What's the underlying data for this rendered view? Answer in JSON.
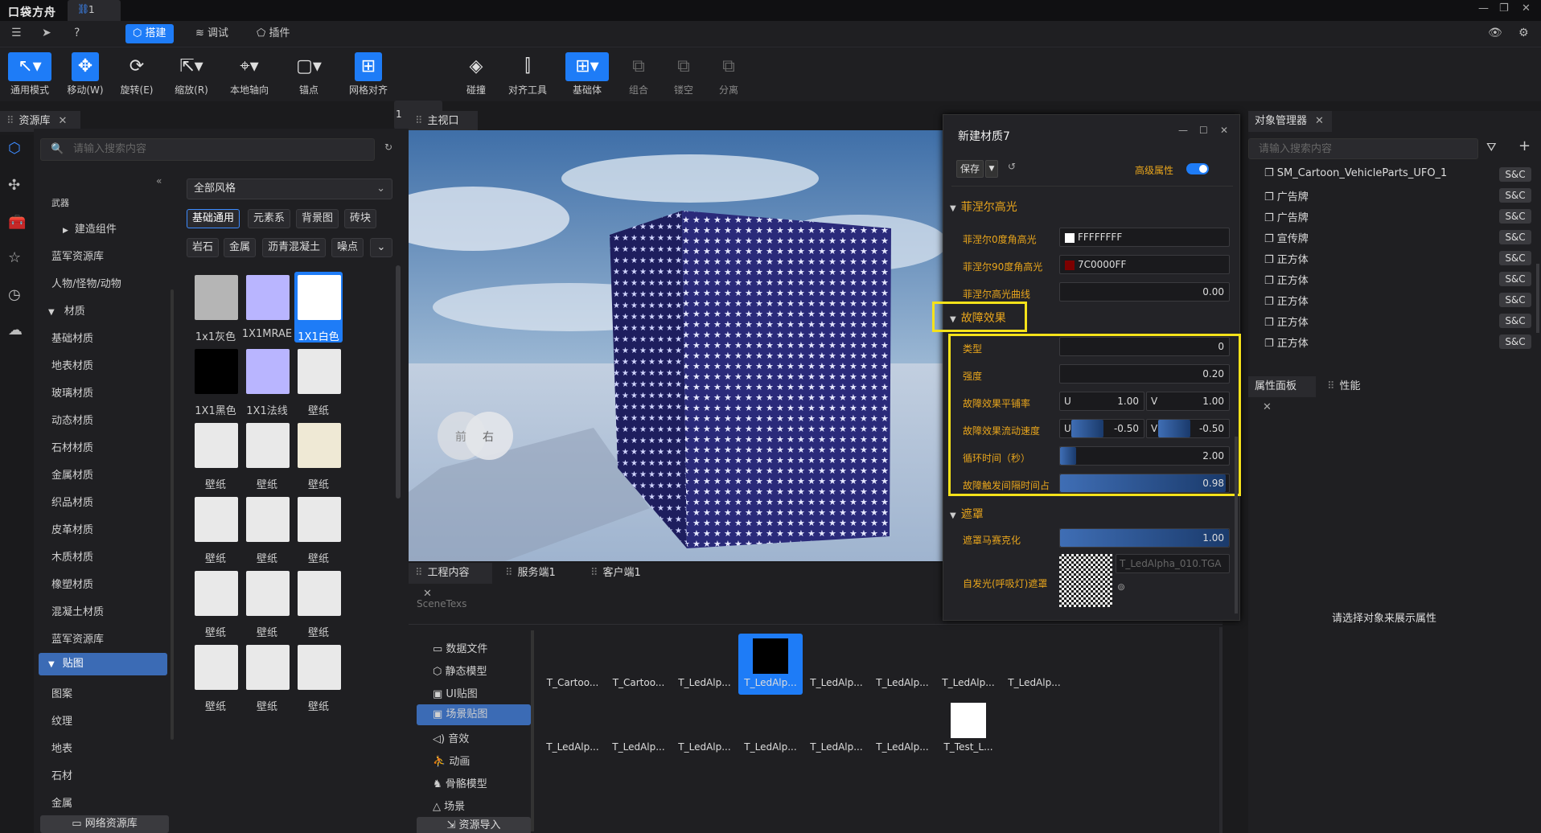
{
  "app": {
    "logo": "口袋方舟",
    "file_tab": "1"
  },
  "menubar": {
    "tabs": [
      {
        "label": "搭建"
      },
      {
        "label": "调试"
      },
      {
        "label": "插件"
      }
    ]
  },
  "toolbar": {
    "items": [
      {
        "label": "通用模式"
      },
      {
        "label": "移动(W)"
      },
      {
        "label": "旋转(E)"
      },
      {
        "label": "缩放(R)"
      },
      {
        "label": "本地轴向"
      },
      {
        "label": "锚点"
      },
      {
        "label": "网格对齐"
      },
      {
        "label": "碰撞"
      },
      {
        "label": "对齐工具"
      },
      {
        "label": "基础体"
      },
      {
        "label": "组合"
      },
      {
        "label": "镂空"
      },
      {
        "label": "分离"
      }
    ],
    "grid_value": "1"
  },
  "assets": {
    "tab": "资源库",
    "search_placeholder": "请输入搜索内容",
    "style_select": "全部风格",
    "tree": [
      "武器",
      "建造组件",
      "蓝军资源库",
      "人物/怪物/动物",
      "材质",
      "基础材质",
      "地表材质",
      "玻璃材质",
      "动态材质",
      "石材材质",
      "金属材质",
      "织品材质",
      "皮革材质",
      "木质材质",
      "橡塑材质",
      "混凝土材质",
      "蓝军资源库",
      "贴图",
      "图案",
      "纹理",
      "地表",
      "石材",
      "金属"
    ],
    "net_button": "网络资源库",
    "chips_row1": [
      "基础通用",
      "元素系",
      "背景图",
      "砖块"
    ],
    "chips_row2": [
      "岩石",
      "金属",
      "沥青混凝土",
      "噪点"
    ],
    "thumbs": [
      "1x1灰色",
      "1X1MRAE",
      "1X1白色",
      "1X1黑色",
      "1X1法线",
      "壁纸",
      "壁纸",
      "壁纸",
      "壁纸",
      "壁纸",
      "壁纸",
      "壁纸",
      "壁纸",
      "壁纸",
      "壁纸",
      "壁纸",
      "壁纸",
      "壁纸"
    ]
  },
  "viewport": {
    "tab": "主视口",
    "gizmo": {
      "left": "前",
      "right": "右"
    }
  },
  "project": {
    "tabs": [
      "工程内容",
      "服务端1",
      "客户端1"
    ],
    "path": "SceneTexs",
    "nav": [
      "数据文件",
      "静态模型",
      "UI贴图",
      "场景贴图",
      "音效",
      "动画",
      "骨骼模型",
      "场景"
    ],
    "import_button": "资源导入",
    "files_row1": [
      "T_Cartoo...",
      "T_Cartoo...",
      "T_LedAlp...",
      "T_LedAlp...",
      "T_LedAlp...",
      "T_LedAlp...",
      "T_LedAlp...",
      "T_LedAlp..."
    ],
    "files_row2": [
      "T_LedAlp...",
      "T_LedAlp...",
      "T_LedAlp...",
      "T_LedAlp...",
      "T_LedAlp...",
      "T_LedAlp...",
      "T_Test_L..."
    ]
  },
  "material": {
    "title": "新建材质7",
    "save": "保存",
    "advanced": "高级属性",
    "fresnel": {
      "section": "菲涅尔高光",
      "labels": [
        "菲涅尔0度角高光",
        "菲涅尔90度角高光",
        "菲涅尔高光曲线"
      ],
      "color0": "FFFFFFFF",
      "color90": "7C0000FF",
      "curve": "0.00"
    },
    "glitch": {
      "section": "故障效果",
      "labels": [
        "类型",
        "强度",
        "故障效果平铺率",
        "故障效果流动速度",
        "循环时间（秒）",
        "故障触发间隔时间占"
      ],
      "type": "0",
      "strength": "0.20",
      "tile_u": "1.00",
      "tile_v": "1.00",
      "flow_u": "-0.50",
      "flow_v": "-0.50",
      "cycle": "2.00",
      "trigger": "0.98",
      "u": "U",
      "v": "V"
    },
    "mask": {
      "section": "遮罩",
      "labels": [
        "遮罩马赛克化",
        "自发光(呼吸灯)遮罩"
      ],
      "mosaic": "1.00",
      "texture": "T_LedAlpha_010.TGA"
    }
  },
  "objects": {
    "tab": "对象管理器",
    "search_placeholder": "请输入搜索内容",
    "rows": [
      "SM_Cartoon_VehicleParts_UFO_1",
      "广告牌",
      "广告牌",
      "宣传牌",
      "正方体",
      "正方体",
      "正方体",
      "正方体",
      "正方体"
    ],
    "badge": "S&C"
  },
  "properties": {
    "tabs": [
      "属性面板",
      "性能"
    ],
    "empty_text": "请选择对象来展示属性"
  }
}
